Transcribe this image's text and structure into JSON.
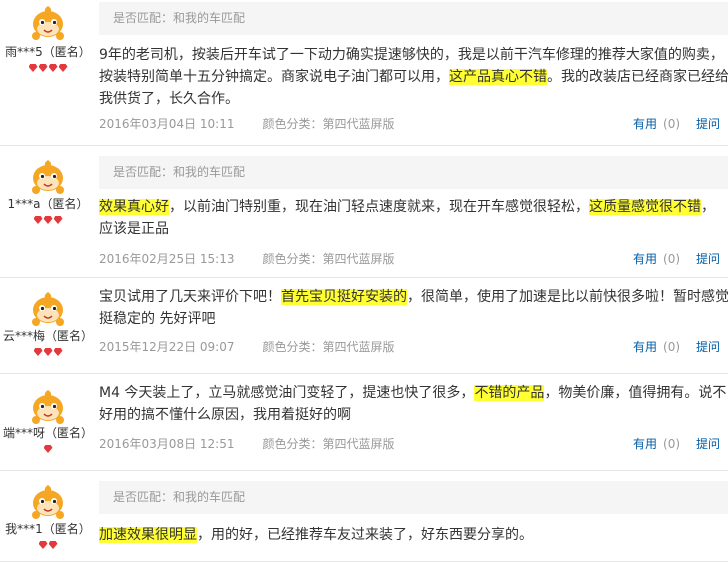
{
  "colors": {
    "highlight": "#ffff33",
    "gem": "#e4393c",
    "link": "#005ea7",
    "muted": "#999999",
    "avatar": "#f5a623"
  },
  "icons": {
    "avatar": "orange-cartoon-avatar-icon",
    "gem": "red-gem-icon"
  },
  "reviews": [
    {
      "user": "雨***5（匿名）",
      "gems": 4,
      "match": "是否匹配：和我的车匹配",
      "lines": [
        [
          "9年的老司机，按装后开车试了一下动力确实提速够快的，我是以前干汽车修理的推荐大家值的购卖，"
        ],
        [
          "按装特别简单十五分钟搞定。商家说电子油门都可以用，",
          "这产品真心不错",
          "。我的改装店已经商家已经给"
        ],
        [
          "我供货了，长久合作。"
        ]
      ],
      "date": "2016年03月04日 10:11",
      "color": "颜色分类：第四代蓝屏版",
      "useful": "有用",
      "count": "(0)",
      "reply": "提问"
    },
    {
      "user": "1***a（匿名）",
      "gems": 3,
      "match": "是否匹配：和我的车匹配",
      "lines": [
        [
          "",
          "效果真心好",
          "，以前油门特别重，现在油门轻点速度就来，现在开车感觉很轻松，",
          "这质量感觉很不错",
          "，"
        ],
        [
          "应该是正品"
        ]
      ],
      "date": "2016年02月25日 15:13",
      "color": "颜色分类：第四代蓝屏版",
      "useful": "有用",
      "count": "(0)",
      "reply": "提问"
    },
    {
      "user": "云***梅（匿名）",
      "gems": 3,
      "match": "",
      "lines": [
        [
          "宝贝试用了几天来评价下吧！",
          "首先宝贝挺好安装的",
          "，很简单，使用了加速是比以前快很多啦！暂时感觉"
        ],
        [
          "挺稳定的 先好评吧"
        ]
      ],
      "date": "2015年12月22日 09:07",
      "color": "颜色分类：第四代蓝屏版",
      "useful": "有用",
      "count": "(0)",
      "reply": "提问"
    },
    {
      "user": "端***呀（匿名）",
      "gems": 1,
      "match": "",
      "lines": [
        [
          "M4 今天装上了，立马就感觉油门变轻了，提速也快了很多，",
          "不错的产品",
          "，物美价廉，值得拥有。说不"
        ],
        [
          "好用的搞不懂什么原因，我用着挺好的啊"
        ]
      ],
      "date": "2016年03月08日 12:51",
      "color": "颜色分类：第四代蓝屏版",
      "useful": "有用",
      "count": "(0)",
      "reply": "提问"
    },
    {
      "user": "我***1（匿名）",
      "gems": 2,
      "match": "是否匹配：和我的车匹配",
      "lines": [
        [
          "",
          "加速效果很明显",
          "，用的好，已经推荐车友过来装了，好东西要分享的。"
        ]
      ],
      "date": "",
      "color": "",
      "useful": "",
      "count": "",
      "reply": ""
    }
  ]
}
